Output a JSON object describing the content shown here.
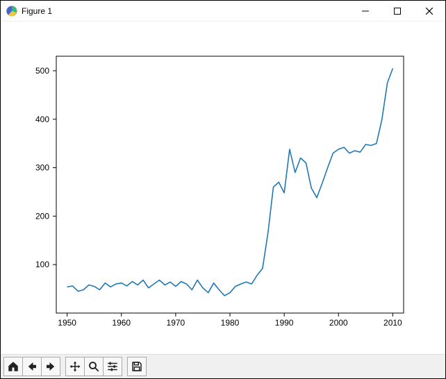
{
  "window": {
    "title": "Figure 1"
  },
  "toolbar": {
    "home": "Home",
    "back": "Back",
    "forward": "Forward",
    "pan": "Pan",
    "zoom": "Zoom",
    "configure": "Configure",
    "save": "Save"
  },
  "chart_data": {
    "type": "line",
    "title": "",
    "xlabel": "",
    "ylabel": "",
    "xlim": [
      1948,
      2012
    ],
    "ylim": [
      0,
      530
    ],
    "xticks": [
      1950,
      1960,
      1970,
      1980,
      1990,
      2000,
      2010
    ],
    "yticks": [
      100,
      200,
      300,
      400,
      500
    ],
    "x": [
      1950,
      1951,
      1952,
      1953,
      1954,
      1955,
      1956,
      1957,
      1958,
      1959,
      1960,
      1961,
      1962,
      1963,
      1964,
      1965,
      1966,
      1967,
      1968,
      1969,
      1970,
      1971,
      1972,
      1973,
      1974,
      1975,
      1976,
      1977,
      1978,
      1979,
      1980,
      1981,
      1982,
      1983,
      1984,
      1985,
      1986,
      1987,
      1988,
      1989,
      1990,
      1991,
      1992,
      1993,
      1994,
      1995,
      1996,
      1997,
      1998,
      1999,
      2000,
      2001,
      2002,
      2003,
      2004,
      2005,
      2006,
      2007,
      2008,
      2009,
      2010
    ],
    "values": [
      54,
      56,
      45,
      48,
      58,
      55,
      48,
      62,
      54,
      60,
      62,
      56,
      65,
      58,
      68,
      52,
      60,
      68,
      58,
      64,
      55,
      65,
      60,
      48,
      68,
      52,
      42,
      62,
      48,
      36,
      42,
      55,
      60,
      64,
      60,
      78,
      92,
      165,
      260,
      270,
      248,
      338,
      290,
      320,
      310,
      258,
      238,
      268,
      300,
      330,
      338,
      342,
      330,
      335,
      332,
      348,
      346,
      350,
      400,
      475,
      505
    ],
    "color": "#1f77b4"
  }
}
